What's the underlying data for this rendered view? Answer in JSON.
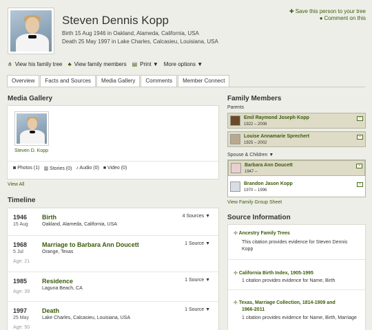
{
  "person": {
    "name": "Steven Dennis Kopp",
    "birth": "Birth 15 Aug 1946 in Oakland, Alameda, California, USA",
    "death": "Death 25 May 1997 in Lake Charles, Calcasieu, Louisiana, USA"
  },
  "header_actions": {
    "save": "Save this person to your tree",
    "comment": "Comment on this"
  },
  "action_bar": {
    "family_tree": "View his family tree",
    "family_members": "View family members",
    "print": "Print ▼",
    "more_options": "More options ▼"
  },
  "tabs": [
    "Overview",
    "Facts and Sources",
    "Media Gallery",
    "Comments",
    "Member Connect"
  ],
  "media": {
    "heading": "Media Gallery",
    "caption": "Steven D. Kopp",
    "photos": "Photos (1)",
    "stories": "Stories (0)",
    "audio": "Audio (0)",
    "video": "Video (0)",
    "view_all": "View All"
  },
  "timeline": {
    "heading": "Timeline",
    "events": [
      {
        "year": "1946",
        "date": "15 Aug",
        "age": "",
        "event": "Birth",
        "place": "Oakland, Alameda, California, USA",
        "sources": "4 Sources ▼"
      },
      {
        "year": "1968",
        "date": "5 Jul",
        "age": "Age: 21",
        "event": "Marriage to Barbara Ann Doucett",
        "place": "Orange, Texas",
        "sources": "1 Source ▼"
      },
      {
        "year": "1985",
        "date": "",
        "age": "Age: 39",
        "event": "Residence",
        "place": "Laguna Beach, CA",
        "sources": "1 Source ▼"
      },
      {
        "year": "1997",
        "date": "25 May",
        "age": "Age: 50",
        "event": "Death",
        "place": "Lake Charles, Calcasieu, Louisiana, USA",
        "sources": "1 Source ▼"
      }
    ]
  },
  "family": {
    "heading": "Family Members",
    "parents_label": "Parents",
    "parents": [
      {
        "name": "Emil Raymond Joseph Kopp",
        "dates": "1922 – 2008"
      },
      {
        "name": "Louise Annamarie Sprechert",
        "dates": "1925 – 2002"
      }
    ],
    "spouse_label": "Spouse & Children ▼",
    "spouse": {
      "name": "Barbara Ann Doucett",
      "dates": "1947 –"
    },
    "children": [
      {
        "name": "Brandon Jason Kopp",
        "dates": "1970 – 1996"
      }
    ],
    "group_sheet": "View Family Group Sheet"
  },
  "sources": {
    "heading": "Source Information",
    "items": [
      {
        "title": "Ancestry Family Trees",
        "desc1": "This citation provides evidence for Steven Dennis",
        "desc2": "Kopp"
      },
      {
        "title": "California Birth Index, 1905-1995",
        "desc1": "1 citation provides evidence for Name, Birth",
        "desc2": ""
      },
      {
        "title": "Texas, Marriage Collection, 1814-1909 and",
        "title2": "1966-2011",
        "desc1": "1 citation provides evidence for Name, Birth, Marriage",
        "desc2": ""
      }
    ]
  },
  "colors": {
    "accent": "#3a5a0a",
    "background": "#eeeee8",
    "card": "#dedbc6"
  }
}
